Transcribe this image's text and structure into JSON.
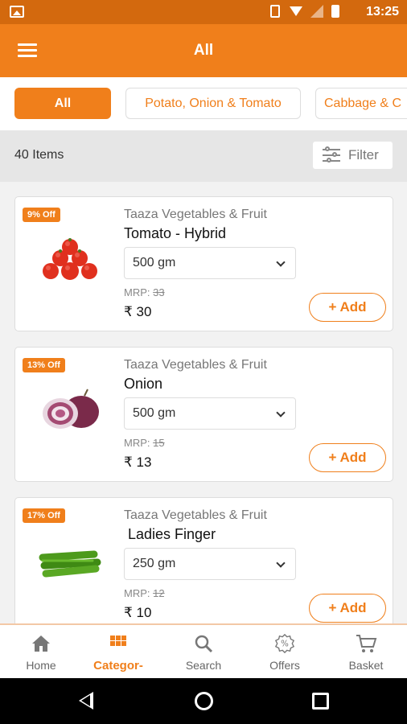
{
  "status_bar": {
    "time": "13:25"
  },
  "app_bar": {
    "title": "All"
  },
  "categories": [
    {
      "label": "All",
      "selected": true
    },
    {
      "label": "Potato, Onion & Tomato",
      "selected": false
    },
    {
      "label": "Cabbage & C",
      "selected": false
    }
  ],
  "list_header": {
    "count_label": "40 Items",
    "filter_label": "Filter"
  },
  "products": [
    {
      "badge": "9% Off",
      "brand": "Taaza Vegetables & Fruit",
      "name": "Tomato - Hybrid",
      "qty": "500 gm",
      "mrp_label": "MRP:",
      "mrp_value": "33",
      "price": "₹ 30",
      "add_label": "+ Add",
      "image": "tomato"
    },
    {
      "badge": "13% Off",
      "brand": "Taaza Vegetables & Fruit",
      "name": "Onion",
      "qty": "500 gm",
      "mrp_label": "MRP:",
      "mrp_value": "15",
      "price": "₹ 13",
      "add_label": "+ Add",
      "image": "onion"
    },
    {
      "badge": "17% Off",
      "brand": "Taaza Vegetables & Fruit",
      "name": " Ladies Finger",
      "qty": "250 gm",
      "mrp_label": "MRP:",
      "mrp_value": "12",
      "price": "₹ 10",
      "add_label": "+ Add",
      "image": "ladies-finger"
    }
  ],
  "bottom_nav": [
    {
      "label": "Home",
      "icon": "home-icon",
      "active": false
    },
    {
      "label": "Categor-",
      "icon": "grid-icon",
      "active": true
    },
    {
      "label": "Search",
      "icon": "search-icon",
      "active": false
    },
    {
      "label": "Offers",
      "icon": "percent-badge-icon",
      "active": false
    },
    {
      "label": "Basket",
      "icon": "cart-icon",
      "active": false
    }
  ],
  "colors": {
    "brand_orange": "#f07f1b",
    "status_bar": "#d3690e"
  }
}
